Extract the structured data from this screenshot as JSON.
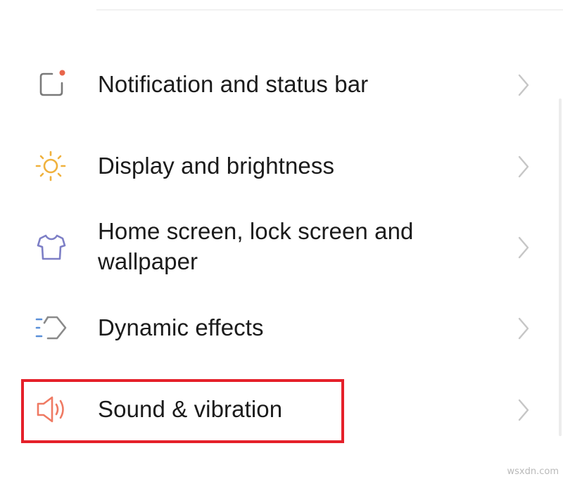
{
  "settings": {
    "items": [
      {
        "label": "Notification and status bar",
        "icon": "notification-square-icon"
      },
      {
        "label": "Display and brightness",
        "icon": "sun-icon"
      },
      {
        "label_line1": "Home screen, lock screen and",
        "label_line2": "wallpaper",
        "icon": "shirt-icon"
      },
      {
        "label": "Dynamic effects",
        "icon": "dynamic-effects-icon"
      },
      {
        "label": "Sound & vibration",
        "icon": "speaker-icon",
        "highlighted": true
      }
    ]
  },
  "colors": {
    "notification_icon": "#7a7a7a",
    "notification_dot": "#e8654a",
    "sun_icon": "#f0b13c",
    "shirt_icon": "#7d7fc6",
    "dynamic_icon_lines": "#5a8fd8",
    "dynamic_icon_shape": "#8a8a8a",
    "speaker_icon": "#ef7a63",
    "highlight": "#e5202a",
    "chevron": "#c6c6c6"
  },
  "watermark": "wsxdn.com"
}
